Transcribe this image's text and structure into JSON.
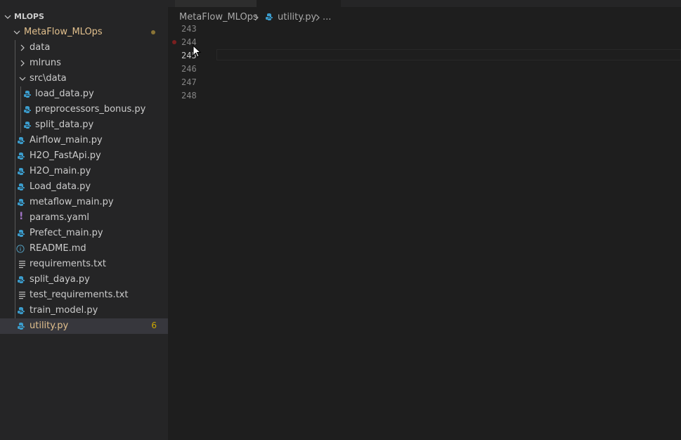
{
  "explorer": {
    "section_title": "MLOPS",
    "root_folder": "MetaFlow_MLOps",
    "items": [
      {
        "label": "data",
        "type": "folder"
      },
      {
        "label": "mlruns",
        "type": "folder"
      },
      {
        "label": "src\\data",
        "type": "folder-open"
      },
      {
        "label": "load_data.py",
        "type": "python"
      },
      {
        "label": "preprocessors_bonus.py",
        "type": "python"
      },
      {
        "label": "split_data.py",
        "type": "python"
      },
      {
        "label": "Airflow_main.py",
        "type": "python"
      },
      {
        "label": "H2O_FastApi.py",
        "type": "python"
      },
      {
        "label": "H2O_main.py",
        "type": "python"
      },
      {
        "label": "Load_data.py",
        "type": "python"
      },
      {
        "label": "metaflow_main.py",
        "type": "python"
      },
      {
        "label": "params.yaml",
        "type": "yaml"
      },
      {
        "label": "Prefect_main.py",
        "type": "python"
      },
      {
        "label": "README.md",
        "type": "info"
      },
      {
        "label": "requirements.txt",
        "type": "text"
      },
      {
        "label": "split_daya.py",
        "type": "python"
      },
      {
        "label": "test_requirements.txt",
        "type": "text"
      },
      {
        "label": "train_model.py",
        "type": "python"
      },
      {
        "label": "utility.py",
        "type": "python",
        "badge": "6"
      }
    ]
  },
  "breadcrumb": {
    "folder": "MetaFlow_MLOps",
    "file": "utility.py",
    "ellipsis": "..."
  },
  "editor": {
    "line_numbers": [
      "243",
      "244",
      "245",
      "246",
      "247",
      "248"
    ]
  },
  "colors": {
    "python_icon": "#3b9ccc",
    "modified_text": "#e2c08d",
    "yaml_icon": "#a074c4",
    "info_icon": "#519aba"
  }
}
